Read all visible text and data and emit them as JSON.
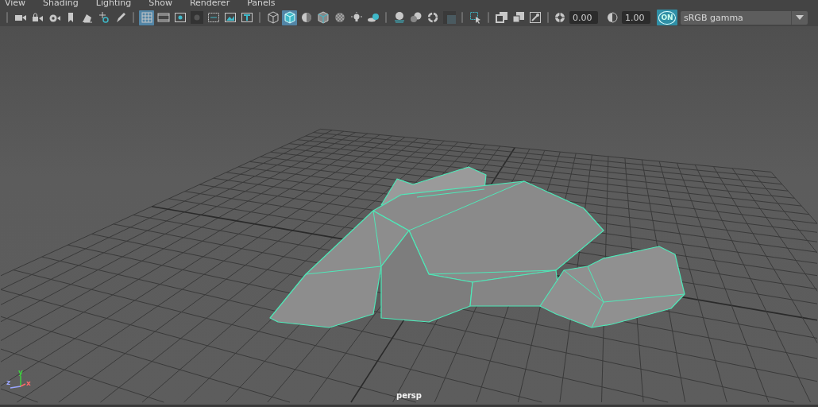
{
  "menu": [
    {
      "label": "View"
    },
    {
      "label": "Shading"
    },
    {
      "label": "Lighting"
    },
    {
      "label": "Show"
    },
    {
      "label": "Renderer"
    },
    {
      "label": "Panels"
    }
  ],
  "toolbar": {
    "groups": [
      [
        {
          "selected": false
        },
        {
          "selected": false
        },
        {
          "selected": false
        },
        {
          "selected": false
        },
        {
          "selected": false
        },
        {
          "selected": false
        },
        {
          "selected": false
        }
      ],
      [
        {
          "selected": true
        },
        {
          "selected": false
        },
        {
          "selected": false
        },
        {
          "selected": false
        },
        {
          "selected": false
        },
        {
          "selected": false
        },
        {
          "selected": false
        }
      ],
      [
        {
          "selected": false
        },
        {
          "selected": true
        },
        {
          "selected": false
        },
        {
          "selected": false
        },
        {
          "selected": false
        },
        {
          "selected": false
        },
        {
          "selected": false
        }
      ],
      [
        {
          "selected": false
        },
        {
          "selected": false
        },
        {
          "selected": false
        },
        {
          "selected": false
        }
      ],
      [
        {
          "selected": false
        }
      ],
      [
        {
          "selected": false
        },
        {
          "selected": false
        },
        {
          "selected": false
        }
      ]
    ],
    "exposure": {
      "value": "0.00"
    },
    "gamma": {
      "value": "1.00"
    },
    "color_management": {
      "label": "ON",
      "on": true
    },
    "view_transform": {
      "value": "sRGB gamma"
    }
  },
  "viewport": {
    "camera": "persp",
    "axes": [
      {
        "label": "y"
      },
      {
        "label": "z"
      },
      {
        "label": "x"
      }
    ]
  }
}
